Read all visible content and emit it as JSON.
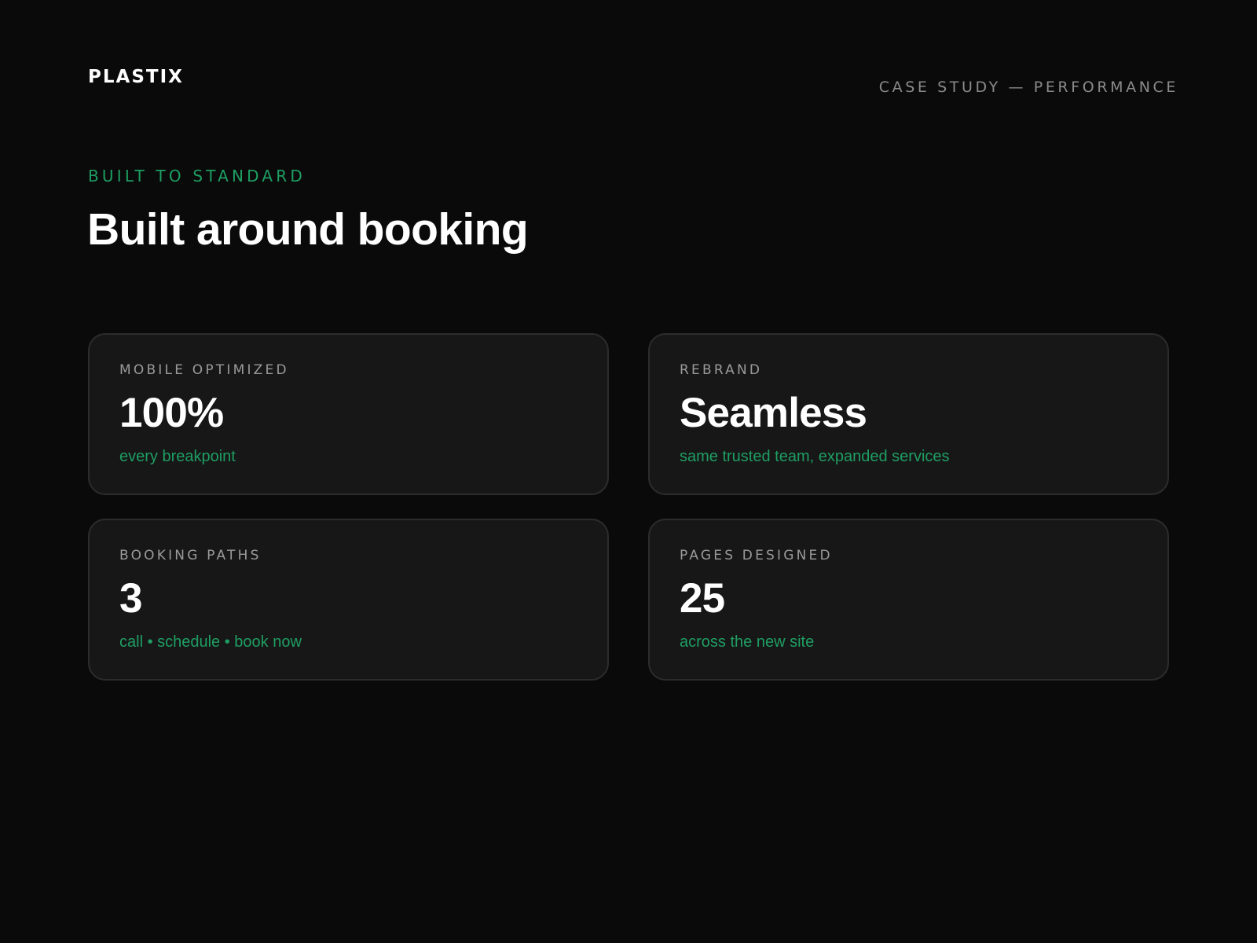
{
  "header": {
    "logo_text": "PLASTIX",
    "tagline": "CASE STUDY — PERFORMANCE"
  },
  "hero": {
    "eyebrow": "BUILT TO STANDARD",
    "headline": "Built around booking"
  },
  "cards": [
    {
      "label": "MOBILE OPTIMIZED",
      "value": "100%",
      "sub": "every breakpoint"
    },
    {
      "label": "REBRAND",
      "value": "Seamless",
      "sub": "same trusted team, expanded services"
    },
    {
      "label": "BOOKING PATHS",
      "value": "3",
      "sub": "call • schedule • book now"
    },
    {
      "label": "PAGES DESIGNED",
      "value": "25",
      "sub": "across the new site"
    }
  ],
  "colors": {
    "background": "#0a0a0a",
    "card_background": "#171717",
    "card_border": "#2c2c2c",
    "accent": "#1e9e63",
    "muted": "#8a8a8a",
    "text": "#ffffff"
  }
}
